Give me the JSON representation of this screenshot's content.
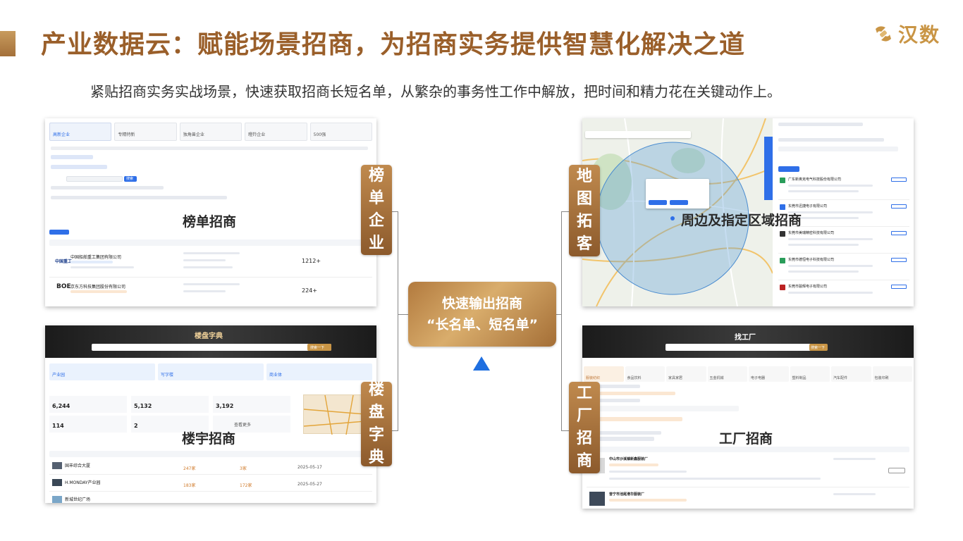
{
  "header": {
    "title": "产业数据云：赋能场景招商，为招商实务提供智慧化解决之道",
    "subtitle": "紧贴招商实务实战场景，快速获取招商长短名单，从繁杂的事务性工作中解放，把时间和精力花在关键动作上。",
    "logo_text": "汉数"
  },
  "center": {
    "line1": "快速输出招商",
    "line2": "“长名单、短名单”"
  },
  "panels": {
    "ranking": {
      "label": "榜单招商",
      "tag": [
        "榜",
        "单",
        "企",
        "业"
      ],
      "tabs": [
        "高新企业",
        "专精特新",
        "独角兽企业",
        "瞪羚企业",
        "500强"
      ],
      "search_button": "搜索",
      "companies": [
        "中国船舶重工集团有限公司",
        "京东方科技集团股份有限公司"
      ],
      "counts": [
        "1212+",
        "224+"
      ],
      "logos": [
        "中国重工",
        "BOE"
      ]
    },
    "building": {
      "label": "楼宇招商",
      "tag": [
        "楼",
        "盘",
        "字",
        "典"
      ],
      "header_title": "楼盘字典",
      "search_button": "搜索一下",
      "categories": [
        "产业园",
        "写字楼",
        "商业体"
      ],
      "stats": [
        "6,244",
        "5,132",
        "3,192",
        "114",
        "2"
      ],
      "more": "查看更多",
      "rows": [
        {
          "name": "国丰综合大厦",
          "value1": "247家",
          "value2": "3家",
          "date": "2025-05-17"
        },
        {
          "name": "H.MONDAY产业园",
          "value1": "183家",
          "value2": "172家",
          "date": "2025-05-27"
        },
        {
          "name": "新城世纪广场",
          "value1": "",
          "value2": "",
          "date": ""
        }
      ]
    },
    "map": {
      "label": "周边及指定区域招商",
      "tag": [
        "地",
        "图",
        "拓",
        "客"
      ],
      "companies": [
        "广东新奥克电气科技股份有限公司",
        "东莞市迅捷电子有限公司",
        "东莞市美瑞精密科技有限公司",
        "东莞市德恒电子科技有限公司",
        "东莞市骏辉电子有限公司"
      ]
    },
    "factory": {
      "label": "工厂招商",
      "tag": [
        "工",
        "厂",
        "招",
        "商"
      ],
      "header_title": "找工厂",
      "search_button": "搜索一下",
      "categories": [
        "服装纺织",
        "食品饮料",
        "家具家居",
        "五金机械",
        "电子电器",
        "塑料制品",
        "汽车配件",
        "包装印刷"
      ],
      "items": [
        "中山市沙溪镇新鑫服装厂",
        "普宁市池尾港华服装厂"
      ]
    }
  },
  "colors": {
    "brand": "#9a5f2a",
    "accent_gold": "#c99545",
    "arrow_blue": "#1f6fe0"
  }
}
